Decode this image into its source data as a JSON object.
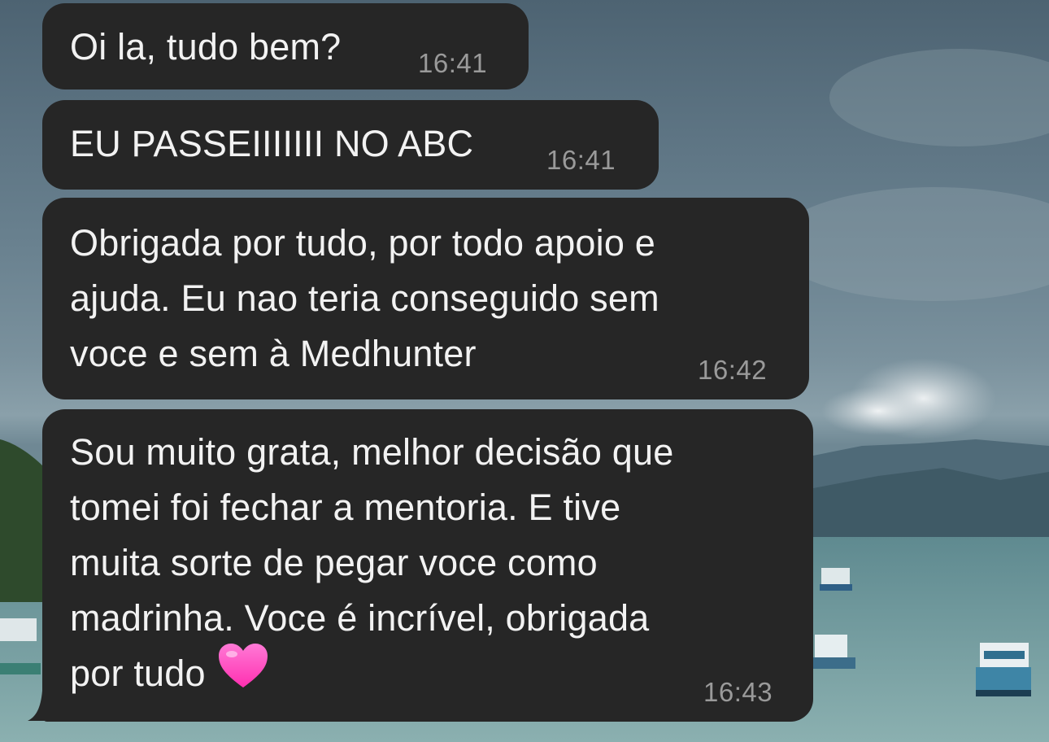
{
  "chat": {
    "messages": [
      {
        "text": "Oi la, tudo bem?",
        "time": "16:41"
      },
      {
        "text": "EU PASSEIIIIIII NO ABC",
        "time": "16:41"
      },
      {
        "text": "Obrigada por tudo, por todo apoio e\najuda. Eu nao teria conseguido sem\nvoce e sem à Medhunter",
        "time": "16:42"
      },
      {
        "text": "Sou muito grata, melhor decisão que\ntomei foi fechar a mentoria. E tive\nmuita sorte de pegar voce como\nmadrinha. Voce é incrível, obrigada\npor tudo",
        "time": "16:43",
        "emoji": "pink-heart"
      }
    ]
  },
  "colors": {
    "bubble": "#262626",
    "text": "#f2f2f2",
    "timestamp": "#9a9a9a",
    "heart": "#ff4fc3"
  }
}
